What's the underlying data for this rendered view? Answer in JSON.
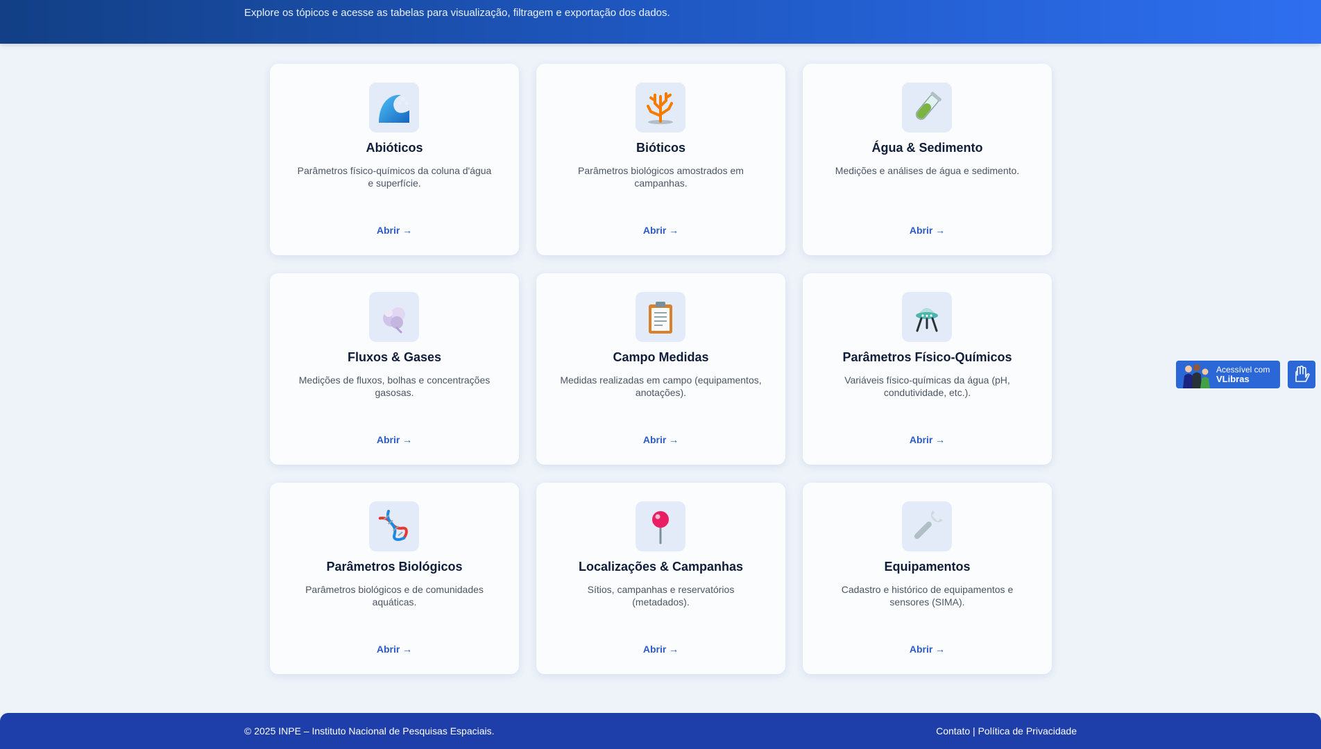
{
  "header": {
    "title": "",
    "subtitle": "Explore os tópicos e acesse as tabelas para visualização, filtragem e exportação dos dados."
  },
  "cards": [
    {
      "icon": "wave-icon",
      "title": "Abióticos",
      "description": "Parâmetros físico-químicos da coluna d'água e superfície.",
      "link": "Abrir →"
    },
    {
      "icon": "coral-icon",
      "title": "Bióticos",
      "description": "Parâmetros biológicos amostrados em campanhas.",
      "link": "Abrir →"
    },
    {
      "icon": "test-tube-icon",
      "title": "Água & Sedimento",
      "description": "Medições e análises de água e sedimento.",
      "link": "Abrir →"
    },
    {
      "icon": "gas-cloud-icon",
      "title": "Fluxos & Gases",
      "description": "Medições de fluxos, bolhas e concentrações gasosas.",
      "link": "Abrir →"
    },
    {
      "icon": "clipboard-icon",
      "title": "Campo Medidas",
      "description": "Medidas realizadas em campo (equipamentos, anotações).",
      "link": "Abrir →"
    },
    {
      "icon": "lab-instrument-icon",
      "title": "Parâmetros Físico-Químicos",
      "description": "Variáveis físico-químicas da água (pH, condutividade, etc.).",
      "link": "Abrir →"
    },
    {
      "icon": "dna-icon",
      "title": "Parâmetros Biológicos",
      "description": "Parâmetros biológicos e de comunidades aquáticas.",
      "link": "Abrir →"
    },
    {
      "icon": "map-pin-icon",
      "title": "Localizações & Campanhas",
      "description": "Sítios, campanhas e reservatórios (metadados).",
      "link": "Abrir →"
    },
    {
      "icon": "wrench-icon",
      "title": "Equipamentos",
      "description": "Cadastro e histórico de equipamentos e sensores (SIMA).",
      "link": "Abrir →"
    }
  ],
  "vlibras": {
    "line1": "Acessível com",
    "line2": "VLibras"
  },
  "footer": {
    "copyright": "© 2025 INPE – Instituto Nacional de Pesquisas Espaciais.",
    "contact": "Contato",
    "separator": " | ",
    "privacy": "Política de Privacidade"
  },
  "colors": {
    "header_start": "#123f85",
    "header_end": "#2e6ff0",
    "footer": "#1e3faa",
    "link": "#2b5bc9",
    "background": "#eef3fa"
  }
}
